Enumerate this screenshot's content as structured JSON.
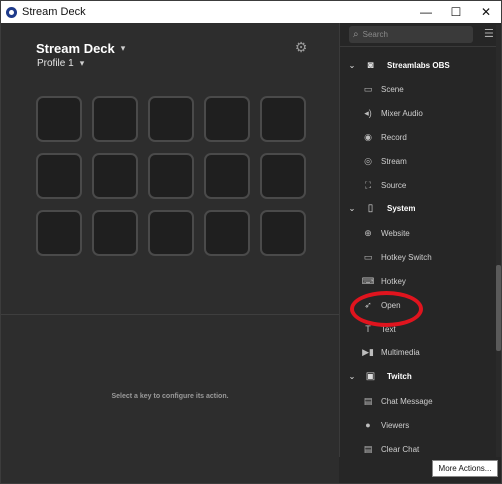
{
  "window": {
    "title": "Stream Deck",
    "controls": {
      "minimize": "—",
      "maximize": "☐",
      "close": "✕"
    }
  },
  "main": {
    "deck_title": "Stream Deck",
    "profile": "Profile 1",
    "hint": "Select a key to configure its action.",
    "keys": 15
  },
  "sidebar": {
    "search_placeholder": "Search",
    "categories": [
      {
        "label": "Streamlabs OBS",
        "items": [
          "Scene",
          "Mixer Audio",
          "Record",
          "Stream",
          "Source"
        ]
      },
      {
        "label": "System",
        "items": [
          "Website",
          "Hotkey Switch",
          "Hotkey",
          "Open",
          "Text",
          "Multimedia"
        ]
      },
      {
        "label": "Twitch",
        "items": [
          "Chat Message",
          "Viewers",
          "Clear Chat"
        ]
      }
    ],
    "more_actions": "More Actions..."
  },
  "colors": {
    "accent_red": "#e0141e",
    "background": "#2d2d2d",
    "sidebar": "#262626"
  }
}
